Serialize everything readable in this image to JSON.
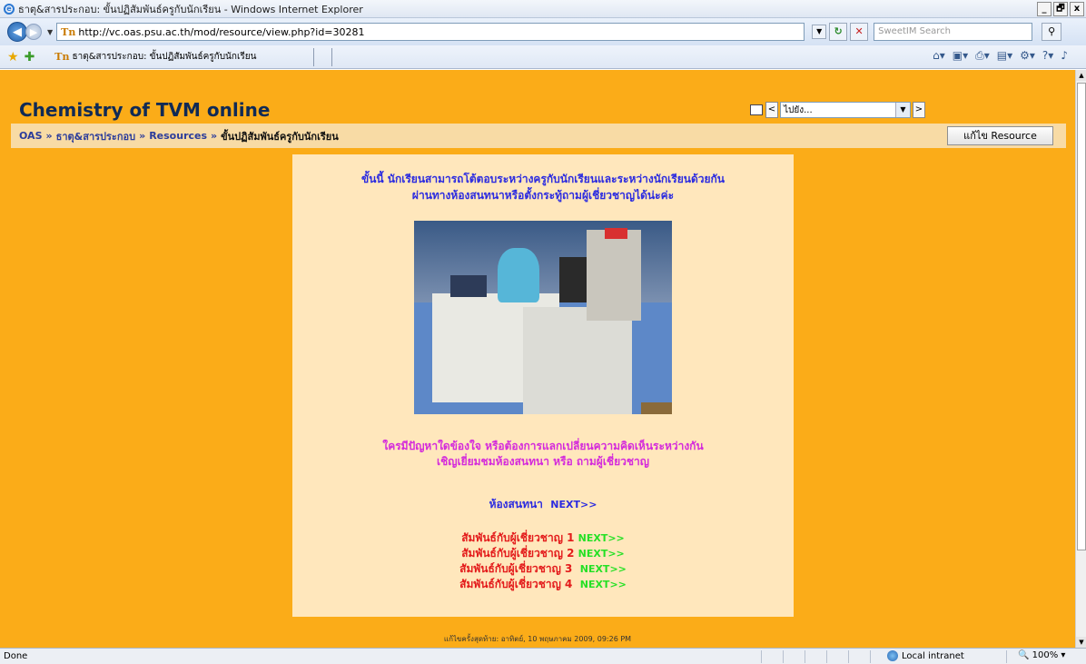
{
  "window": {
    "title": "ธาตุ&สารประกอบ: ขั้นปฏิสัมพันธ์ครูกับนักเรียน - Windows Internet Explorer",
    "minimize": "_",
    "restore": "🗗",
    "close": "x"
  },
  "navbar": {
    "back_icon": "back-arrow-icon",
    "forward_icon": "forward-arrow-icon",
    "url": "http://vc.oas.psu.ac.th/mod/resource/view.php?id=30281",
    "search_placeholder": "SweetIM Search",
    "refresh_glyph": "↻",
    "stop_glyph": "✕",
    "search_glyph": "⚲"
  },
  "favbar": {
    "tab_title": "ธาตุ&สารประกอบ: ขั้นปฏิสัมพันธ์ครูกับนักเรียน",
    "site_icon_text": "Tn"
  },
  "page": {
    "site_title": "Chemistry of TVM online",
    "jump_prev": "<",
    "jump_next": ">",
    "jump_select": "ไปยัง...",
    "breadcrumb": {
      "oas": "OAS",
      "course": "ธาตุ&สารประกอบ",
      "resources": "Resources",
      "current": "ขั้นปฏิสัมพันธ์ครูกับนักเรียน",
      "sep": "»"
    },
    "edit_button": "แก้ไข Resource",
    "intro_line1": "ขั้นนี้ นักเรียนสามารถโต้ตอบระหว่างครูกับนักเรียนและระหว่างนักเรียนด้วยกัน",
    "intro_line2": "ผ่านทางห้องสนทนาหรือตั้งกระทู้ถามผู้เชี่ยวชาญได้น่ะค่ะ",
    "problem_line1": "ใครมีปัญหาใดข้องใจ หรือต้องการแลกเปลี่ยนความคิดเห็นระหว่างกัน",
    "problem_line2": "เชิญเยี่ยมชมห้องสนทนา หรือ ถามผู้เชี่ยวชาญ",
    "chat_label": "ห้องสนทนา",
    "next_label": "NEXT>>",
    "experts": [
      "สัมพันธ์กับผู้เชี่ยวชาญ 1",
      "สัมพันธ์กับผู้เชี่ยวชาญ 2",
      "สัมพันธ์กับผู้เชี่ยวชาญ 3",
      "สัมพันธ์กับผู้เชี่ยวชาญ 4"
    ],
    "footer": "แก้ไขครั้งสุดท้าย: อาทิตย์, 10 พฤษภาคม 2009, 09:26 PM"
  },
  "statusbar": {
    "status": "Done",
    "zone": "Local intranet",
    "zoom": "100%",
    "zoom_prefix": "🔍"
  }
}
